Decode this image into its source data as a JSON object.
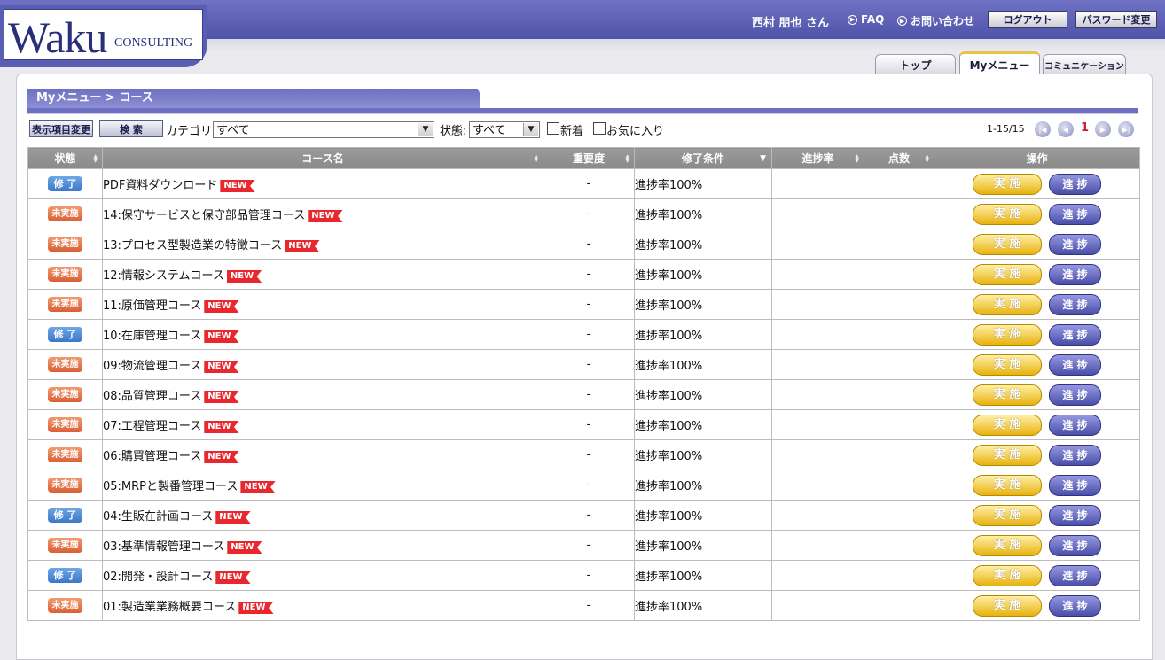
{
  "header": {
    "logo_big": "Waku",
    "logo_small": "CONSULTING",
    "user": "西村 朋也 さん",
    "faq": "FAQ",
    "contact": "お問い合わせ",
    "logout": "ログアウト",
    "password": "パスワード変更"
  },
  "tabs": [
    "トップ",
    "Myメニュー",
    "コミュニケーション"
  ],
  "breadcrumb": "Myメニュー > コース",
  "toolbar": {
    "display_change": "表示項目変更",
    "search": "検 索",
    "category_label": "カテゴリ:",
    "category_value": "すべて",
    "status_label": "状態:",
    "status_value": "すべて",
    "new_label": "新着",
    "fav_label": "お気に入り"
  },
  "pager": {
    "count": "1-15/15",
    "page": "1"
  },
  "columns": [
    "状態",
    "コース名",
    "重要度",
    "修了条件",
    "進捗率",
    "点数",
    "操作"
  ],
  "buttons": {
    "run": "実 施",
    "progress": "進 捗"
  },
  "new_tag": "NEW",
  "rows": [
    {
      "status": "修 了",
      "done": true,
      "name": "PDF資料ダウンロード",
      "importance": "-",
      "condition": "進捗率100%"
    },
    {
      "status": "未実施",
      "done": false,
      "name": "14:保守サービスと保守部品管理コース",
      "importance": "-",
      "condition": "進捗率100%"
    },
    {
      "status": "未実施",
      "done": false,
      "name": "13:プロセス型製造業の特徴コース",
      "importance": "-",
      "condition": "進捗率100%"
    },
    {
      "status": "未実施",
      "done": false,
      "name": "12:情報システムコース",
      "importance": "-",
      "condition": "進捗率100%"
    },
    {
      "status": "未実施",
      "done": false,
      "name": "11:原価管理コース",
      "importance": "-",
      "condition": "進捗率100%"
    },
    {
      "status": "修 了",
      "done": true,
      "name": "10:在庫管理コース",
      "importance": "-",
      "condition": "進捗率100%"
    },
    {
      "status": "未実施",
      "done": false,
      "name": "09:物流管理コース",
      "importance": "-",
      "condition": "進捗率100%"
    },
    {
      "status": "未実施",
      "done": false,
      "name": "08:品質管理コース",
      "importance": "-",
      "condition": "進捗率100%"
    },
    {
      "status": "未実施",
      "done": false,
      "name": "07:工程管理コース",
      "importance": "-",
      "condition": "進捗率100%"
    },
    {
      "status": "未実施",
      "done": false,
      "name": "06:購買管理コース",
      "importance": "-",
      "condition": "進捗率100%"
    },
    {
      "status": "未実施",
      "done": false,
      "name": "05:MRPと製番管理コース",
      "importance": "-",
      "condition": "進捗率100%"
    },
    {
      "status": "修 了",
      "done": true,
      "name": "04:生販在計画コース",
      "importance": "-",
      "condition": "進捗率100%"
    },
    {
      "status": "未実施",
      "done": false,
      "name": "03:基準情報管理コース",
      "importance": "-",
      "condition": "進捗率100%"
    },
    {
      "status": "修 了",
      "done": true,
      "name": "02:開発・設計コース",
      "importance": "-",
      "condition": "進捗率100%"
    },
    {
      "status": "未実施",
      "done": false,
      "name": "01:製造業業務概要コース",
      "importance": "-",
      "condition": "進捗率100%"
    }
  ]
}
